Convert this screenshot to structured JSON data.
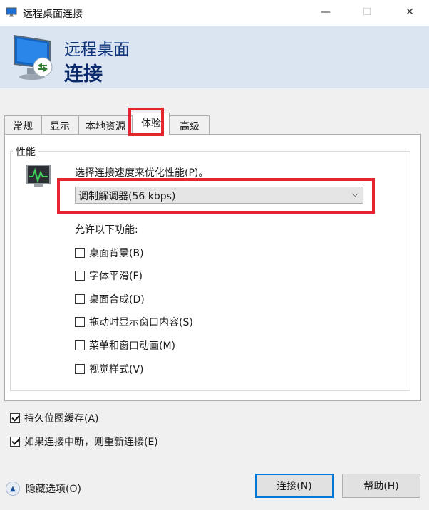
{
  "window": {
    "title": "远程桌面连接",
    "minimize": "—",
    "maximize": "☐",
    "close": "✕"
  },
  "banner": {
    "line1": "远程桌面",
    "line2": "连接"
  },
  "tabs": [
    {
      "label": "常规"
    },
    {
      "label": "显示"
    },
    {
      "label": "本地资源"
    },
    {
      "label": "体验",
      "active": true
    },
    {
      "label": "高级"
    }
  ],
  "performance": {
    "group_label": "性能",
    "speed_label": "选择连接速度来优化性能(P)。",
    "speed_value": "调制解调器(56 kbps)",
    "allow_label": "允许以下功能:",
    "features": [
      {
        "label": "桌面背景(B)",
        "checked": false
      },
      {
        "label": "字体平滑(F)",
        "checked": false
      },
      {
        "label": "桌面合成(D)",
        "checked": false
      },
      {
        "label": "拖动时显示窗口内容(S)",
        "checked": false
      },
      {
        "label": "菜单和窗口动画(M)",
        "checked": false
      },
      {
        "label": "视觉样式(V)",
        "checked": false
      }
    ]
  },
  "options": [
    {
      "label": "持久位图缓存(A)",
      "checked": true
    },
    {
      "label": "如果连接中断，则重新连接(E)",
      "checked": true
    }
  ],
  "footer": {
    "hide_options": "隐藏选项(O)",
    "connect": "连接(N)",
    "help": "帮助(H)"
  },
  "colors": {
    "banner_bg": "#dbe5f1",
    "banner_text": "#0a2a6b",
    "highlight": "#e3262e",
    "focus_border": "#0078d7"
  }
}
